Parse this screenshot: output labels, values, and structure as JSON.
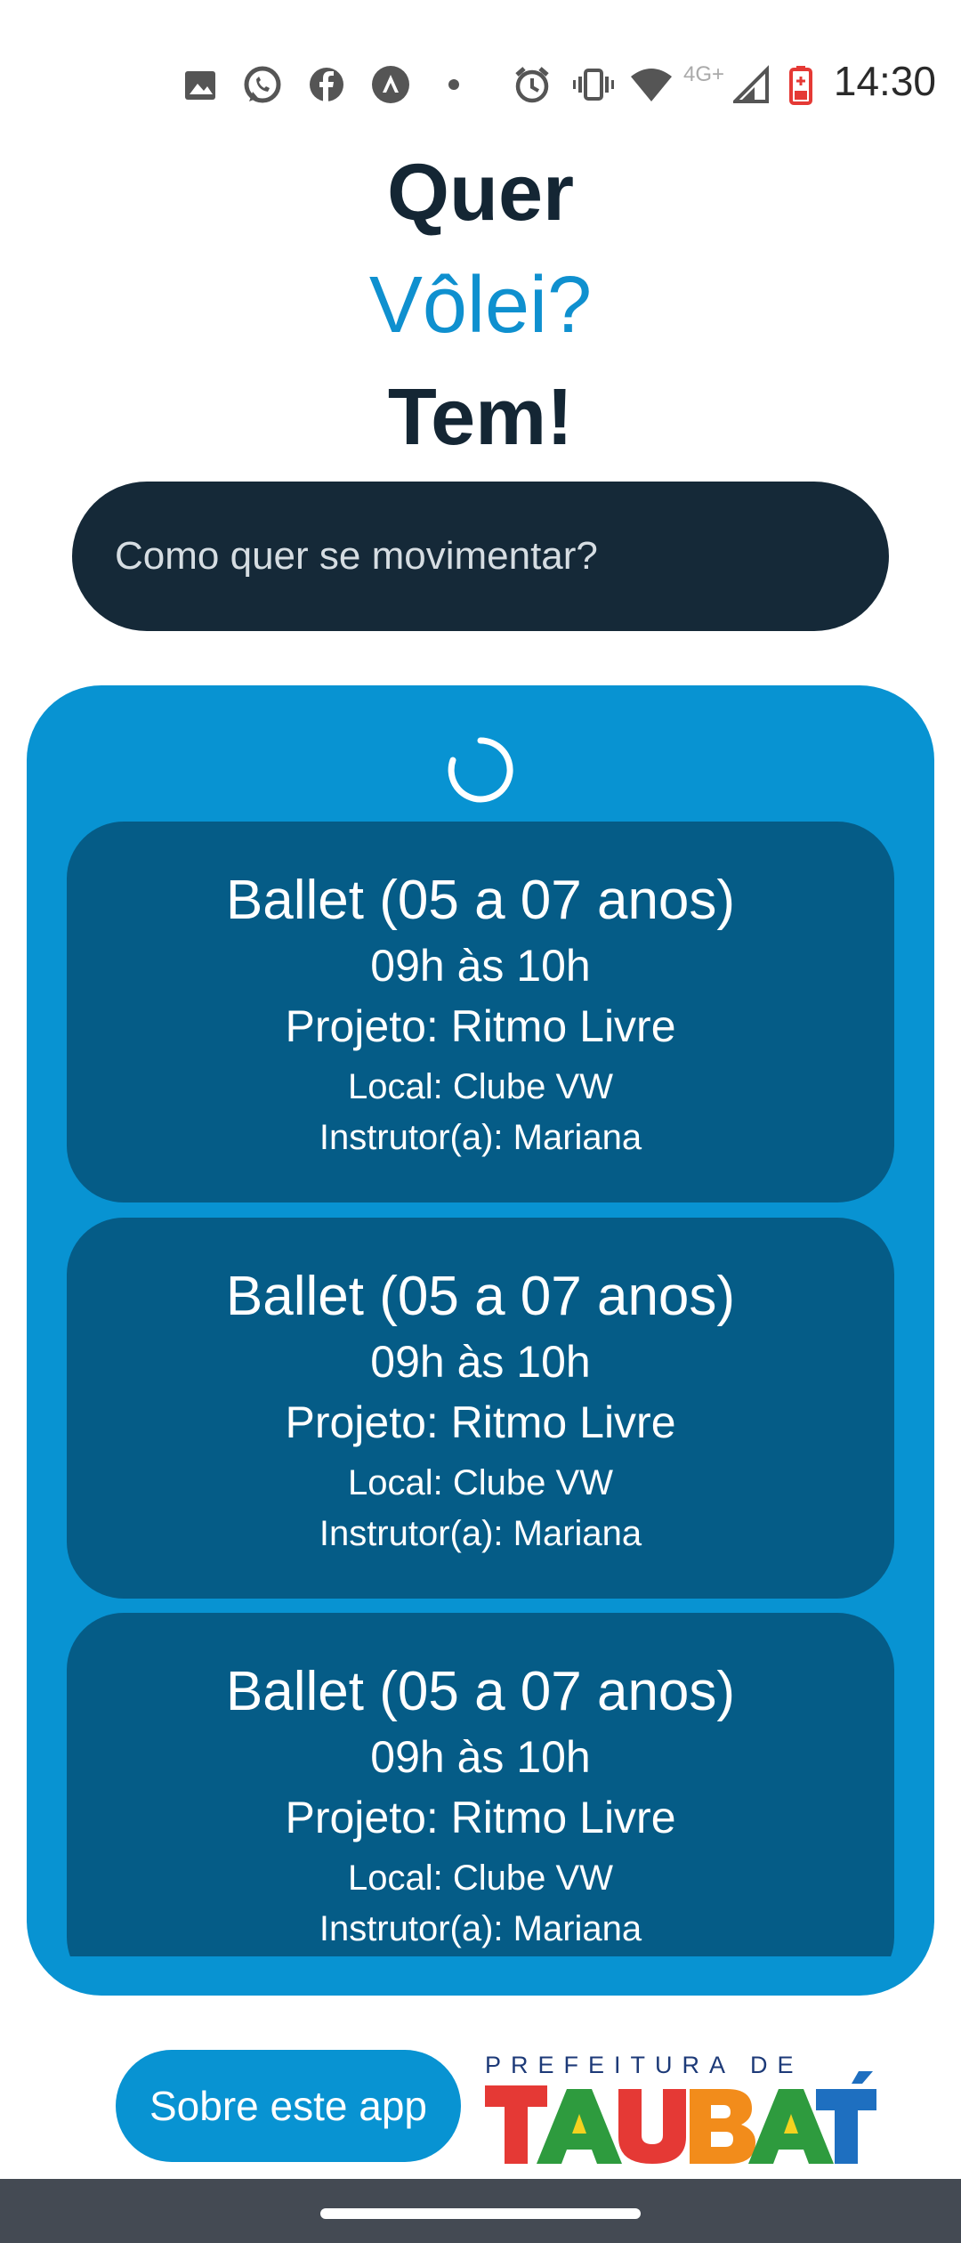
{
  "status_bar": {
    "time": "14:30",
    "network_label": "4G+",
    "icons": [
      "gallery-icon",
      "whatsapp-icon",
      "facebook-icon",
      "app-icon",
      "dot-icon",
      "alarm-icon",
      "vibrate-icon",
      "wifi-icon",
      "signal-icon",
      "battery-icon"
    ]
  },
  "header": {
    "line1": "Quer",
    "line2": "Vôlei?",
    "line3": "Tem!"
  },
  "search": {
    "placeholder": "Como quer se movimentar?",
    "value": ""
  },
  "results": {
    "loading": true,
    "items": [
      {
        "title": "Ballet (05 a 07 anos)",
        "time": "09h às 10h",
        "project": "Projeto: Ritmo Livre",
        "location": "Local: Clube VW",
        "instructor": "Instrutor(a): Mariana"
      },
      {
        "title": "Ballet (05 a 07 anos)",
        "time": "09h às 10h",
        "project": "Projeto: Ritmo Livre",
        "location": "Local: Clube VW",
        "instructor": "Instrutor(a): Mariana"
      },
      {
        "title": "Ballet (05 a 07 anos)",
        "time": "09h às 10h",
        "project": "Projeto: Ritmo Livre",
        "location": "Local: Clube VW",
        "instructor": "Instrutor(a): Mariana"
      }
    ]
  },
  "footer": {
    "about_label": "Sobre este app",
    "logo_top": "PREFEITURA DE",
    "logo_main": "TAUBATÉ"
  },
  "colors": {
    "brand_blue": "#0893d2",
    "card_blue": "#055c87",
    "dark_navy": "#152938",
    "logo_red": "#e53935",
    "logo_green": "#2e9b3e",
    "logo_orange": "#f28c1b",
    "logo_blue": "#1e6fc0"
  }
}
